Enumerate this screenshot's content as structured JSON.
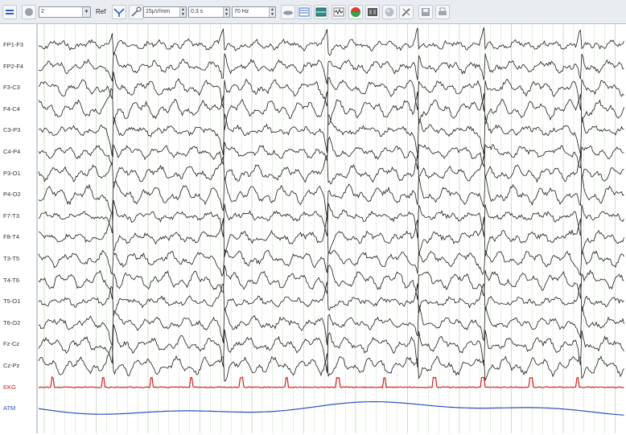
{
  "toolbar": {
    "montage_value": "2",
    "ref_label": "Ref",
    "sensitivity_value": "15µV/mm",
    "time_constant_value": "0.3 s",
    "filter_value": "70 Hz"
  },
  "channels": [
    {
      "label": "FP1-F3",
      "color": "#1a1a1a"
    },
    {
      "label": "FP2-F4",
      "color": "#1a1a1a"
    },
    {
      "label": "F3-C3",
      "color": "#1a1a1a"
    },
    {
      "label": "F4-C4",
      "color": "#1a1a1a"
    },
    {
      "label": "C3-P3",
      "color": "#1a1a1a"
    },
    {
      "label": "C4-P4",
      "color": "#1a1a1a"
    },
    {
      "label": "P3-O1",
      "color": "#1a1a1a"
    },
    {
      "label": "P4-O2",
      "color": "#1a1a1a"
    },
    {
      "label": "F7-T3",
      "color": "#1a1a1a"
    },
    {
      "label": "F8-T4",
      "color": "#1a1a1a"
    },
    {
      "label": "T3-T5",
      "color": "#1a1a1a"
    },
    {
      "label": "T4-T6",
      "color": "#1a1a1a"
    },
    {
      "label": "T5-O1",
      "color": "#1a1a1a"
    },
    {
      "label": "T6-O2",
      "color": "#1a1a1a"
    },
    {
      "label": "Fz-Cz",
      "color": "#1a1a1a"
    },
    {
      "label": "Cz-Pz",
      "color": "#1a1a1a"
    },
    {
      "label": "EKG",
      "color": "#d62020"
    },
    {
      "label": "ATM",
      "color": "#2a4fc0"
    }
  ],
  "colors": {
    "grid": "#c8dcc0",
    "trace": "#1a1a1a",
    "ekg": "#d62020",
    "atm": "#2a4fc0"
  }
}
